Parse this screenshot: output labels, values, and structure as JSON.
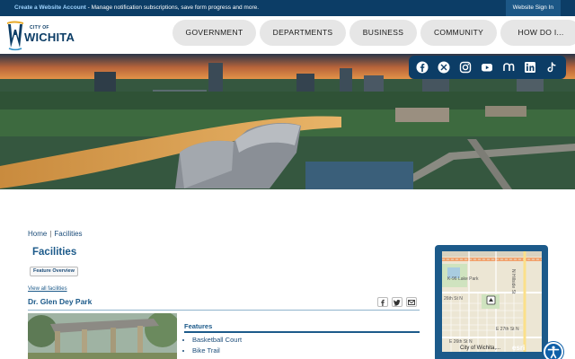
{
  "topbar": {
    "create_link": "Create a Website Account",
    "message": " - Manage notification subscriptions, save form progress and more.",
    "signin": "Website Sign In"
  },
  "logo": {
    "city_of": "CITY OF",
    "name": "WICHITA"
  },
  "nav": [
    {
      "label": "GOVERNMENT"
    },
    {
      "label": "DEPARTMENTS"
    },
    {
      "label": "BUSINESS"
    },
    {
      "label": "COMMUNITY"
    },
    {
      "label": "HOW DO I..."
    }
  ],
  "social_icons": [
    "facebook-icon",
    "x-icon",
    "instagram-icon",
    "youtube-icon",
    "nextdoor-icon",
    "linkedin-icon",
    "tiktok-icon"
  ],
  "breadcrumb": {
    "home": "Home",
    "separator": "|",
    "current": "Facilities"
  },
  "page_title": "Facilities",
  "overview_button": "Feature Overview",
  "view_all": "View all facilities",
  "park_name": "Dr. Glen Dey Park",
  "features_label": "Features",
  "features": [
    "Basketball Court",
    "Bike Trail"
  ],
  "map": {
    "labels": {
      "lake_park": "K-96 Lake Park",
      "st_26": "26th St N",
      "st_27": "E 27th St N",
      "st_e26": "E 26th St N",
      "hillside": "N Hillside St",
      "attribution": "City of Wichita,...",
      "esri": "esri"
    }
  },
  "colors": {
    "brand": "#0c3d66",
    "link": "#1c5a8a",
    "nav_bg": "#e6e6e6"
  }
}
